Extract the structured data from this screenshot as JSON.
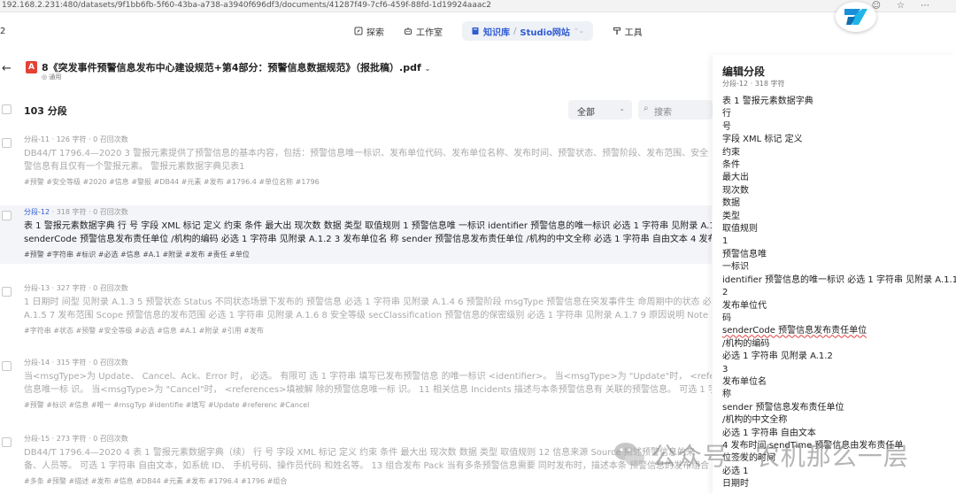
{
  "browser": {
    "url": "192.168.2.231:480/datasets/9f1bb6fb-5f60-43ba-a738-a3940f696df3/documents/41287f49-7cf6-459f-88fd-1d19924aaac2"
  },
  "left_edge_digit": "2",
  "nav": {
    "explore": "探索",
    "studio": "工作室",
    "knowledge": "知识库",
    "studio_site": "Studio网站",
    "tools": "工具"
  },
  "document": {
    "title": "8《突发事件预警信息发布中心建设规范+第4部分：预警信息数据规范》（报批稿）.pdf",
    "subtitle": "通用",
    "badge": "A"
  },
  "toolbar": {
    "segment_count": "103 分段",
    "filter_value": "全部",
    "search_placeholder": "搜索"
  },
  "segments": [
    {
      "id": "分段-11",
      "chars": "126 字符",
      "recalls": "0 召回次数",
      "lines": [
        "DB44/T 1796.4—2020 3 警报元素提供了预警信息的基本内容，包括：预警信息唯一标识、发布单位代码、发布单位名称、发布时间、预警状态、预警阶段、发布范围、安全",
        "警信息有且仅有一个警报元素。 警报元素数据字典见表1"
      ],
      "tags": "#预警 #安全等级 #2020 #信息 #警报 #DB44 #元素 #发布 #1796.4 #单位名称 #1796"
    },
    {
      "id": "分段-12",
      "chars": "318 字符",
      "recalls": "0 召回次数",
      "lines": [
        "表 1 警报元素数据字典 行 号 字段 XML 标记 定义 约束 条件 最大出 现次数 数据 类型 取值规则 1 预警信息唯 一标识 identifier 预警信息的唯一标识 必选 1 字符串 见附录 A.1",
        "senderCode 预警信息发布责任单位 /机构的编码 必选 1 字符串 见附录 A.1.2 3 发布单位名 称 sender 预警信息发布责任单位 /机构的中文全称 必选 1 字符串 自由文本 4 发布"
      ],
      "tags": "#预警 #字符串 #标识 #必选 #信息 #A.1 #附录 #发布 #责任 #单位"
    },
    {
      "id": "分段-13",
      "chars": "327 字符",
      "recalls": "0 召回次数",
      "lines": [
        "1 日期时 间型 见附录 A.1.3 5 预警状态 Status 不同状态场景下发布的 预警信息 必选 1 字符串 见附录 A.1.4 6 预警阶段 msgType 预警信息在突发事件生 命周期中的状态 必选",
        "A.1.5 7 发布范围 Scope 预警信息的发布范围 必选 1 字符串 见附录 A.1.6 8 安全等级 secClassification 预警信息的保密级别 必选 1 字符串 见附录 A.1.7 9 原因说明 Note 对预"
      ],
      "tags": "#字符串 #状态 #预警 #安全等级 #必选 #信息 #A.1 #附录 #引用 #发布"
    },
    {
      "id": "分段-14",
      "chars": "315 字符",
      "recalls": "0 召回次数",
      "lines": [
        "当<msgType>为 Update、 Cancel、Ack、Error 时， 必选。 有限可 选 1 字符串 填写已发布预警信息 的唯一标识 <identifier>。 当<msgType>为 \"Update\"时， <referen",
        "信息唯一标 识。 当<msgType>为 \"Cancel\"时， <references>填被解 除的预警信息唯一标 识。 11 相关信息 Incidents 描述与本条预警信息有 关联的预警信息。 可选 1 字符"
      ],
      "tags": "#预警 #标识 #信息 #唯一 #msgTyp #identifie #填写 #Update #referenc #Cancel"
    },
    {
      "id": "分段-15",
      "chars": "273 字符",
      "recalls": "0 召回次数",
      "lines": [
        "DB44/T 1796.4—2020 4 表 1 警报元素数据字典（续） 行 号 字段 XML 标记 定义 约束 条件 最大出 现次数 数据 类型 取值规则 12 信息来源 Source 描述预警信息的来",
        "备、人员等。 可选 1 字符串 自由文本，如系统 ID、 手机号码、操作员代码 和姓名等。 13 组合发布 Pack 当有多条预警信息需要 同时发布时，描述本条 预警信息的发布组合"
      ],
      "tags": "#多条 #预警 #描述 #发布 #信息 #DB44 #元素 #发布 #1796.4 #1796 #组合"
    }
  ],
  "edit_panel": {
    "title": "编辑分段",
    "segment_id": "分段-12",
    "chars": "318 字符",
    "lines": [
      "表 1 警报元素数据字典",
      "行",
      "号",
      "字段 XML 标记 定义",
      "约束",
      "条件",
      "最大出",
      "现次数",
      "数据",
      "类型",
      "取值规则",
      "1",
      "预警信息唯",
      "一标识",
      "identifier 预警信息的唯一标识 必选 1 字符串 见附录 A.1.1",
      "2",
      "发布单位代",
      "码",
      "senderCode 预警信息发布责任单位",
      "/机构的编码",
      "必选 1 字符串 见附录 A.1.2",
      "3",
      "发布单位名",
      "称",
      "sender 预警信息发布责任单位",
      "/机构的中文全称",
      "必选 1 字符串 自由文本",
      "4 发布时间 sendTime 预警信息由发布责任单",
      "位签发的时间",
      "必选 1",
      "日期时"
    ]
  },
  "watermark": {
    "text": "公众号 · 农机那么一层"
  }
}
